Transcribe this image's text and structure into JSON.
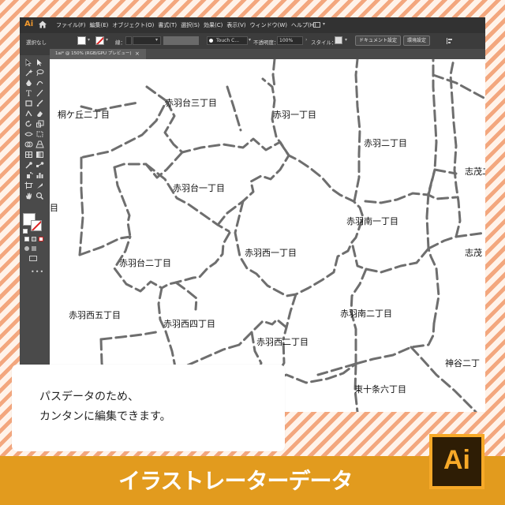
{
  "app": {
    "logo": "Ai",
    "menu": [
      "ファイル(F)",
      "編集(E)",
      "オブジェクト(O)",
      "書式(T)",
      "選択(S)",
      "効果(C)",
      "表示(V)",
      "ウィンドウ(W)",
      "ヘルプ(H)"
    ]
  },
  "control": {
    "selection": "選択なし",
    "stroke_label": "線：",
    "brush": "Touch C...",
    "opacity_label": "不透明度：",
    "opacity": "100%",
    "style_label": "スタイル：",
    "doc_settings": "ドキュメント設定",
    "prefs": "環境設定"
  },
  "document": {
    "tab_title": "1ai* @ 150% (RGB/GPU プレビュー)",
    "close": "×"
  },
  "map": {
    "labels": [
      "桐ケ丘二丁目",
      "赤羽台三丁目",
      "赤羽一丁目",
      "赤羽二丁目",
      "志茂二丁",
      "赤羽台一丁目",
      "赤羽南一丁目",
      "赤羽西一丁目",
      "志茂",
      "赤羽台二丁目",
      "赤羽西五丁目",
      "赤羽西四丁目",
      "赤羽南二丁目",
      "赤羽西二丁目",
      "神谷二丁",
      "東十条六丁目",
      "目"
    ]
  },
  "caption": {
    "line1": "パスデータのため、",
    "line2": "カンタンに編集できます。"
  },
  "banner": {
    "text": "イラストレーターデータ",
    "badge": "Ai"
  },
  "colors": {
    "accent": "#e29b1e",
    "badge_bg": "#2e1d05",
    "badge_fg": "#f7a928",
    "ui_dark": "#323232",
    "stripe": "#f3a77e"
  }
}
